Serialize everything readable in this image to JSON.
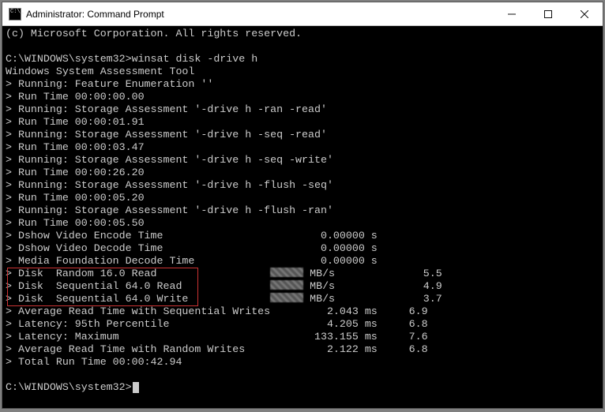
{
  "window": {
    "title": "Administrator: Command Prompt"
  },
  "terminal": {
    "copyright": "(c) Microsoft Corporation. All rights reserved.",
    "prompt1": "C:\\WINDOWS\\system32>",
    "command": "winsat disk -drive h",
    "header": "Windows System Assessment Tool",
    "lines": [
      "> Running: Feature Enumeration ''",
      "> Run Time 00:00:00.00",
      "> Running: Storage Assessment '-drive h -ran -read'",
      "> Run Time 00:00:01.91",
      "> Running: Storage Assessment '-drive h -seq -read'",
      "> Run Time 00:00:03.47",
      "> Running: Storage Assessment '-drive h -seq -write'",
      "> Run Time 00:00:26.20",
      "> Running: Storage Assessment '-drive h -flush -seq'",
      "> Run Time 00:00:05.20",
      "> Running: Storage Assessment '-drive h -flush -ran'",
      "> Run Time 00:00:05.50"
    ],
    "metrics": [
      {
        "label": "> Dshow Video Encode Time",
        "val": "0.00000 s",
        "score": ""
      },
      {
        "label": "> Dshow Video Decode Time",
        "val": "0.00000 s",
        "score": ""
      },
      {
        "label": "> Media Foundation Decode Time",
        "val": "0.00000 s",
        "score": ""
      }
    ],
    "diskrows": [
      {
        "label": "> Disk  Random 16.0 Read",
        "unit": " MB/s",
        "score": "5.5"
      },
      {
        "label": "> Disk  Sequential 64.0 Read",
        "unit": " MB/s",
        "score": "4.9"
      },
      {
        "label": "> Disk  Sequential 64.0 Write",
        "unit": " MB/s",
        "score": "3.7"
      }
    ],
    "tail": [
      {
        "label": "> Average Read Time with Sequential Writes",
        "val": "2.043 ms",
        "score": "6.9"
      },
      {
        "label": "> Latency: 95th Percentile",
        "val": "4.205 ms",
        "score": "6.8"
      },
      {
        "label": "> Latency: Maximum",
        "val": "133.155 ms",
        "score": "7.6"
      },
      {
        "label": "> Average Read Time with Random Writes",
        "val": "2.122 ms",
        "score": "6.8"
      }
    ],
    "total": "> Total Run Time 00:00:42.94",
    "prompt2": "C:\\WINDOWS\\system32>"
  }
}
